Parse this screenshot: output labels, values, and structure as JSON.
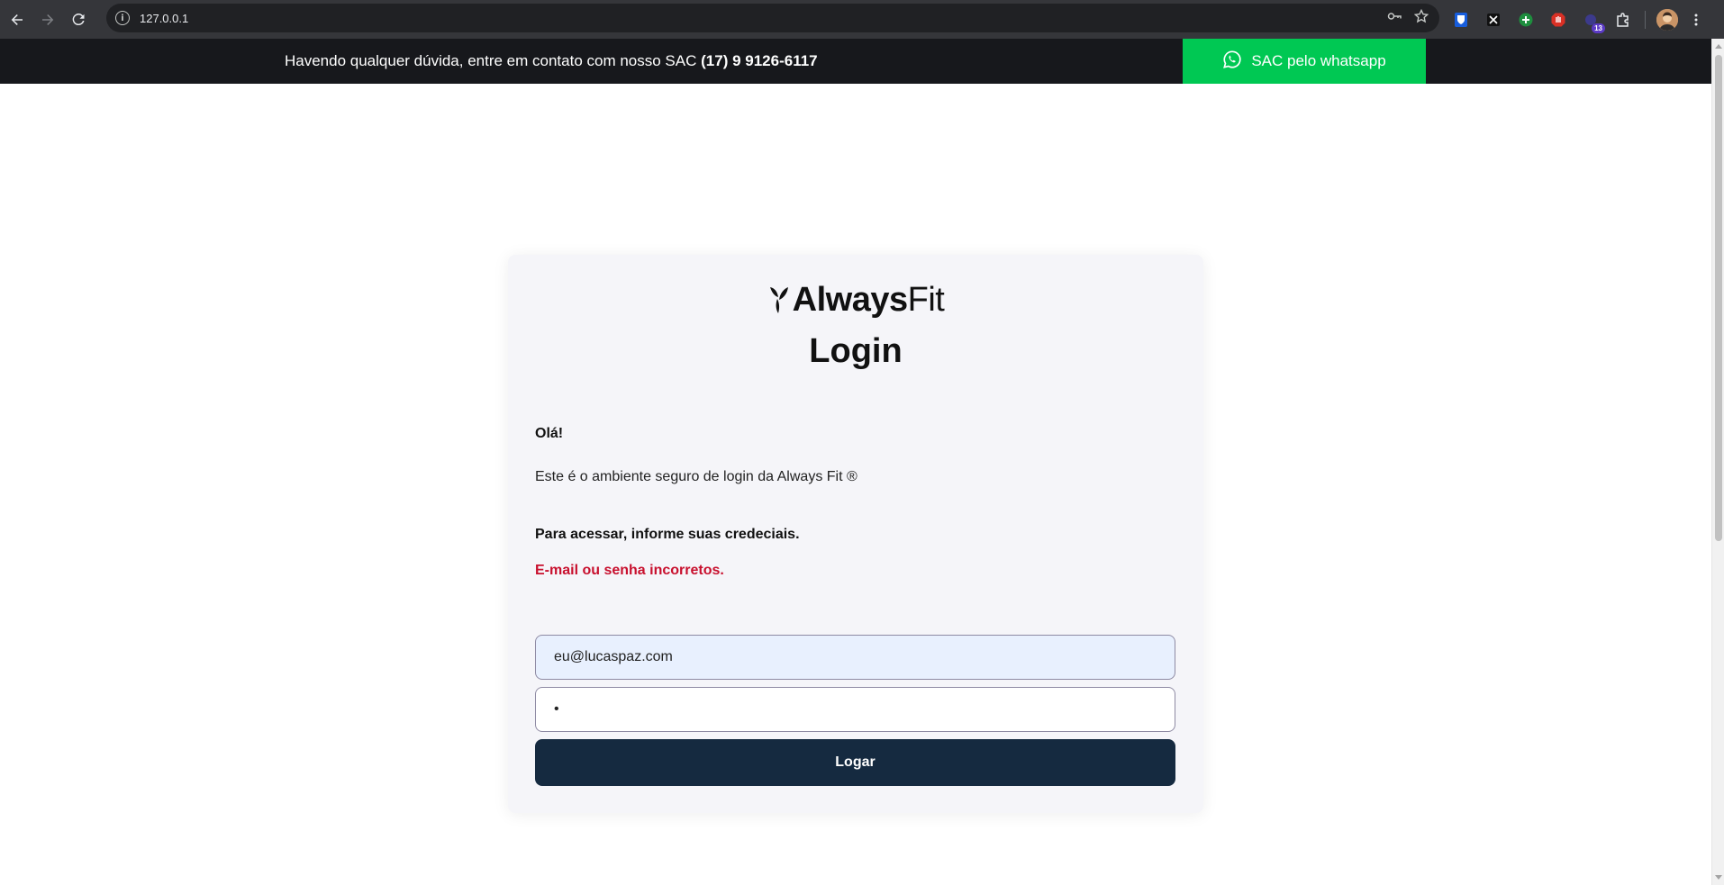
{
  "browser": {
    "url": "127.0.0.1",
    "extension_badge": "13"
  },
  "banner": {
    "text": "Havendo qualquer dúvida, entre em contato com nosso SAC",
    "phone": "(17) 9 9126-6117",
    "whatsapp_label": "SAC pelo whatsapp",
    "whatsapp_color": "#00c853"
  },
  "login": {
    "logo_strong": "Always",
    "logo_light": "Fit",
    "title": "Login",
    "greeting": "Olá!",
    "intro": "Este é o ambiente seguro de login da Always Fit ®",
    "instructions": "Para acessar, informe suas credeciais.",
    "error": "E-mail ou senha incorretos.",
    "error_color": "#c8102e",
    "email_value": "eu@lucaspaz.com",
    "password_value": "•",
    "submit_label": "Logar",
    "submit_color": "#152a40"
  }
}
